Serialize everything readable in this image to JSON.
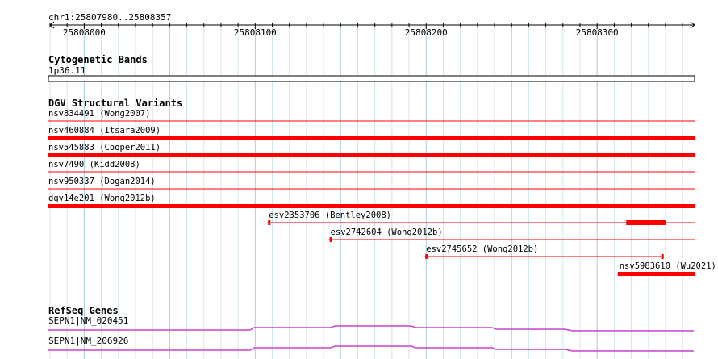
{
  "ruler": {
    "location": "chr1:25807980..25808357",
    "start": 25807980,
    "end": 25808357,
    "tick_labels": [
      "25808000",
      "25808100",
      "25808200",
      "25808300"
    ]
  },
  "colors": {
    "grid_major": "#a8cde0",
    "grid_minor": "#cfe4ee",
    "variant": "#ff0000",
    "gene": "#cc44cc",
    "text": "#000000"
  },
  "tracks": {
    "cytoband": {
      "title": "Cytogenetic Bands",
      "label": "1p36.11"
    },
    "dgv": {
      "title": "DGV Structural Variants",
      "features": [
        {
          "label": "nsv834491 (Wong2007)",
          "start": 25807980,
          "end": 25808357,
          "style": "thin"
        },
        {
          "label": "nsv460884 (Itsara2009)",
          "start": 25807980,
          "end": 25808357,
          "style": "thick"
        },
        {
          "label": "nsv545883 (Cooper2011)",
          "start": 25807980,
          "end": 25808357,
          "style": "thick"
        },
        {
          "label": "nsv7490 (Kidd2008)",
          "start": 25807980,
          "end": 25808357,
          "style": "thin"
        },
        {
          "label": "nsv950337 (Dogan2014)",
          "start": 25807980,
          "end": 25808357,
          "style": "thin"
        },
        {
          "label": "dgv14e201 (Wong2012b)",
          "start": 25807980,
          "end": 25808357,
          "style": "thick"
        },
        {
          "label": "esv2353706 (Bentley2008)",
          "start": 25808108,
          "end": 25808357,
          "style": "thin",
          "extra_thick": [
            25808317,
            25808340
          ]
        },
        {
          "label": "esv2742604 (Wong2012b)",
          "start": 25808144,
          "end": 25808357,
          "style": "thin"
        },
        {
          "label": "esv2745652 (Wong2012b)",
          "start": 25808200,
          "end": 25808338,
          "style": "thin"
        },
        {
          "label": "nsv5983610 (Wu2021)",
          "start": 25808313,
          "end": 25808357,
          "style": "thick"
        }
      ]
    },
    "refseq": {
      "title": "RefSeq Genes",
      "genes": [
        {
          "label": "SEPN1|NM_020451"
        },
        {
          "label": "SEPN1|NM_206926"
        }
      ]
    }
  }
}
